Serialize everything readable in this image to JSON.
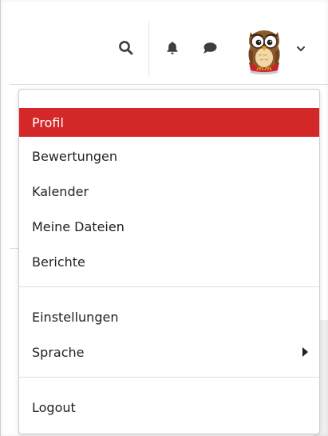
{
  "header": {
    "icons": {
      "search": "search-icon",
      "notifications": "bell-icon",
      "messages": "chat-bubble-icon",
      "avatar": "owl-avatar",
      "expand": "chevron-down-icon"
    }
  },
  "user_menu": {
    "items": [
      {
        "label": "Profil",
        "active": true
      },
      {
        "label": "Bewertungen"
      },
      {
        "label": "Kalender"
      },
      {
        "label": "Meine Dateien"
      },
      {
        "label": "Berichte"
      },
      {
        "label": "Einstellungen"
      },
      {
        "label": "Sprache",
        "has_submenu": true
      },
      {
        "label": "Logout"
      }
    ]
  },
  "colors": {
    "accent": "#d42727",
    "icon": "#3a3f44",
    "text": "#1d2125"
  }
}
